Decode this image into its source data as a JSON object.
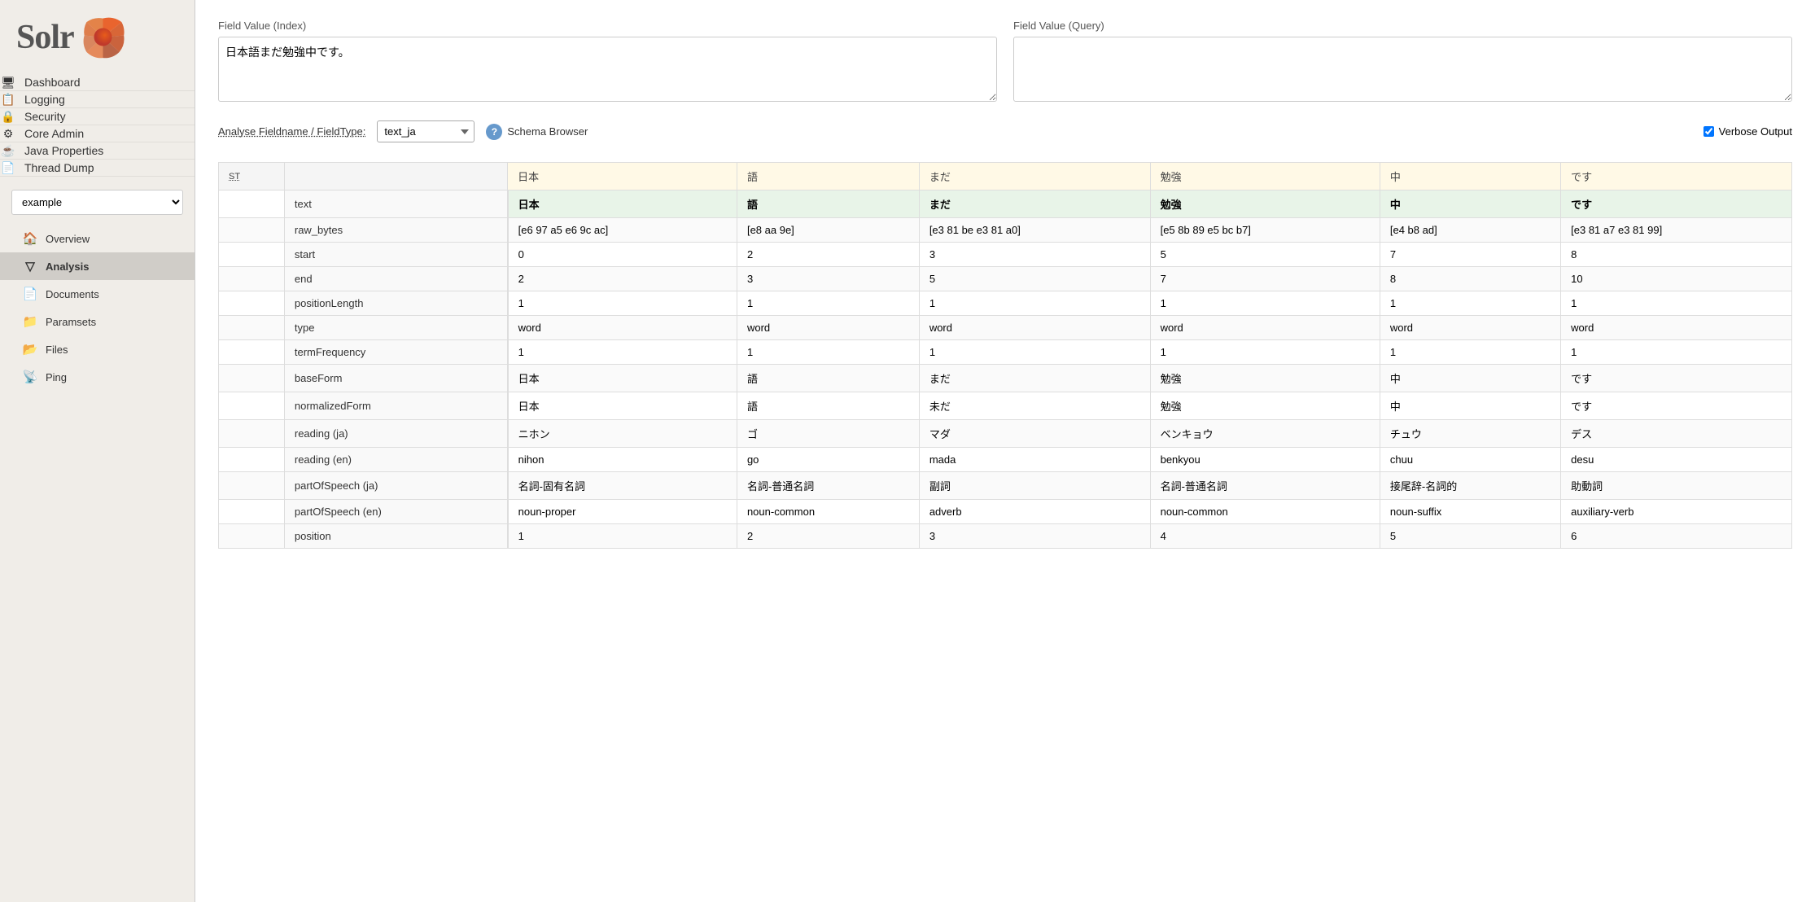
{
  "sidebar": {
    "logo_text": "Solr",
    "nav_items": [
      {
        "label": "Dashboard",
        "icon": "dashboard"
      },
      {
        "label": "Logging",
        "icon": "logging"
      },
      {
        "label": "Security",
        "icon": "security"
      },
      {
        "label": "Core Admin",
        "icon": "core-admin"
      },
      {
        "label": "Java Properties",
        "icon": "java-properties"
      },
      {
        "label": "Thread Dump",
        "icon": "thread-dump"
      }
    ],
    "core_selector": {
      "value": "example",
      "options": [
        "example"
      ]
    },
    "core_nav_items": [
      {
        "label": "Overview",
        "icon": "home"
      },
      {
        "label": "Analysis",
        "icon": "filter",
        "active": true
      },
      {
        "label": "Documents",
        "icon": "documents"
      },
      {
        "label": "Paramsets",
        "icon": "paramsets"
      },
      {
        "label": "Files",
        "icon": "files"
      },
      {
        "label": "Ping",
        "icon": "ping"
      }
    ]
  },
  "main": {
    "field_value_index_label": "Field Value (Index)",
    "field_value_index_value": "日本語まだ勉強中です。",
    "field_value_query_label": "Field Value (Query)",
    "field_value_query_value": "",
    "analyse_label": "Analyse Fieldname / FieldType:",
    "fieldtype_value": "text_ja",
    "fieldtype_options": [
      "text_ja"
    ],
    "schema_browser_label": "Schema Browser",
    "verbose_output_label": "Verbose Output",
    "verbose_output_checked": true,
    "table": {
      "st_col": "ST",
      "row_label_col": "",
      "tokens": [
        "日本",
        "語",
        "まだ",
        "勉強",
        "中",
        "です"
      ],
      "rows": [
        {
          "label": "text",
          "values": [
            "日本",
            "語",
            "まだ",
            "勉強",
            "中",
            "です"
          ]
        },
        {
          "label": "raw_bytes",
          "values": [
            "[e6 97 a5 e6 9c ac]",
            "[e8 aa 9e]",
            "[e3 81 be e3 81 a0]",
            "[e5 8b 89 e5 bc b7]",
            "[e4 b8 ad]",
            "[e3 81 a7 e3 81 99]"
          ]
        },
        {
          "label": "start",
          "values": [
            "0",
            "2",
            "3",
            "5",
            "7",
            "8"
          ]
        },
        {
          "label": "end",
          "values": [
            "2",
            "3",
            "5",
            "7",
            "8",
            "10"
          ]
        },
        {
          "label": "positionLength",
          "values": [
            "1",
            "1",
            "1",
            "1",
            "1",
            "1"
          ]
        },
        {
          "label": "type",
          "values": [
            "word",
            "word",
            "word",
            "word",
            "word",
            "word"
          ]
        },
        {
          "label": "termFrequency",
          "values": [
            "1",
            "1",
            "1",
            "1",
            "1",
            "1"
          ]
        },
        {
          "label": "baseForm",
          "values": [
            "日本",
            "語",
            "まだ",
            "勉強",
            "中",
            "です"
          ]
        },
        {
          "label": "normalizedForm",
          "values": [
            "日本",
            "語",
            "未だ",
            "勉強",
            "中",
            "です"
          ]
        },
        {
          "label": "reading (ja)",
          "values": [
            "ニホン",
            "ゴ",
            "マダ",
            "ベンキョウ",
            "チュウ",
            "デス"
          ]
        },
        {
          "label": "reading (en)",
          "values": [
            "nihon",
            "go",
            "mada",
            "benkyou",
            "chuu",
            "desu"
          ]
        },
        {
          "label": "partOfSpeech (ja)",
          "values": [
            "名詞-固有名詞",
            "名詞-普通名詞",
            "副詞",
            "名詞-普通名詞",
            "接尾辞-名詞的",
            "助動詞"
          ]
        },
        {
          "label": "partOfSpeech (en)",
          "values": [
            "noun-proper",
            "noun-common",
            "adverb",
            "noun-common",
            "noun-suffix",
            "auxiliary-verb"
          ]
        },
        {
          "label": "position",
          "values": [
            "1",
            "2",
            "3",
            "4",
            "5",
            "6"
          ]
        }
      ]
    }
  }
}
